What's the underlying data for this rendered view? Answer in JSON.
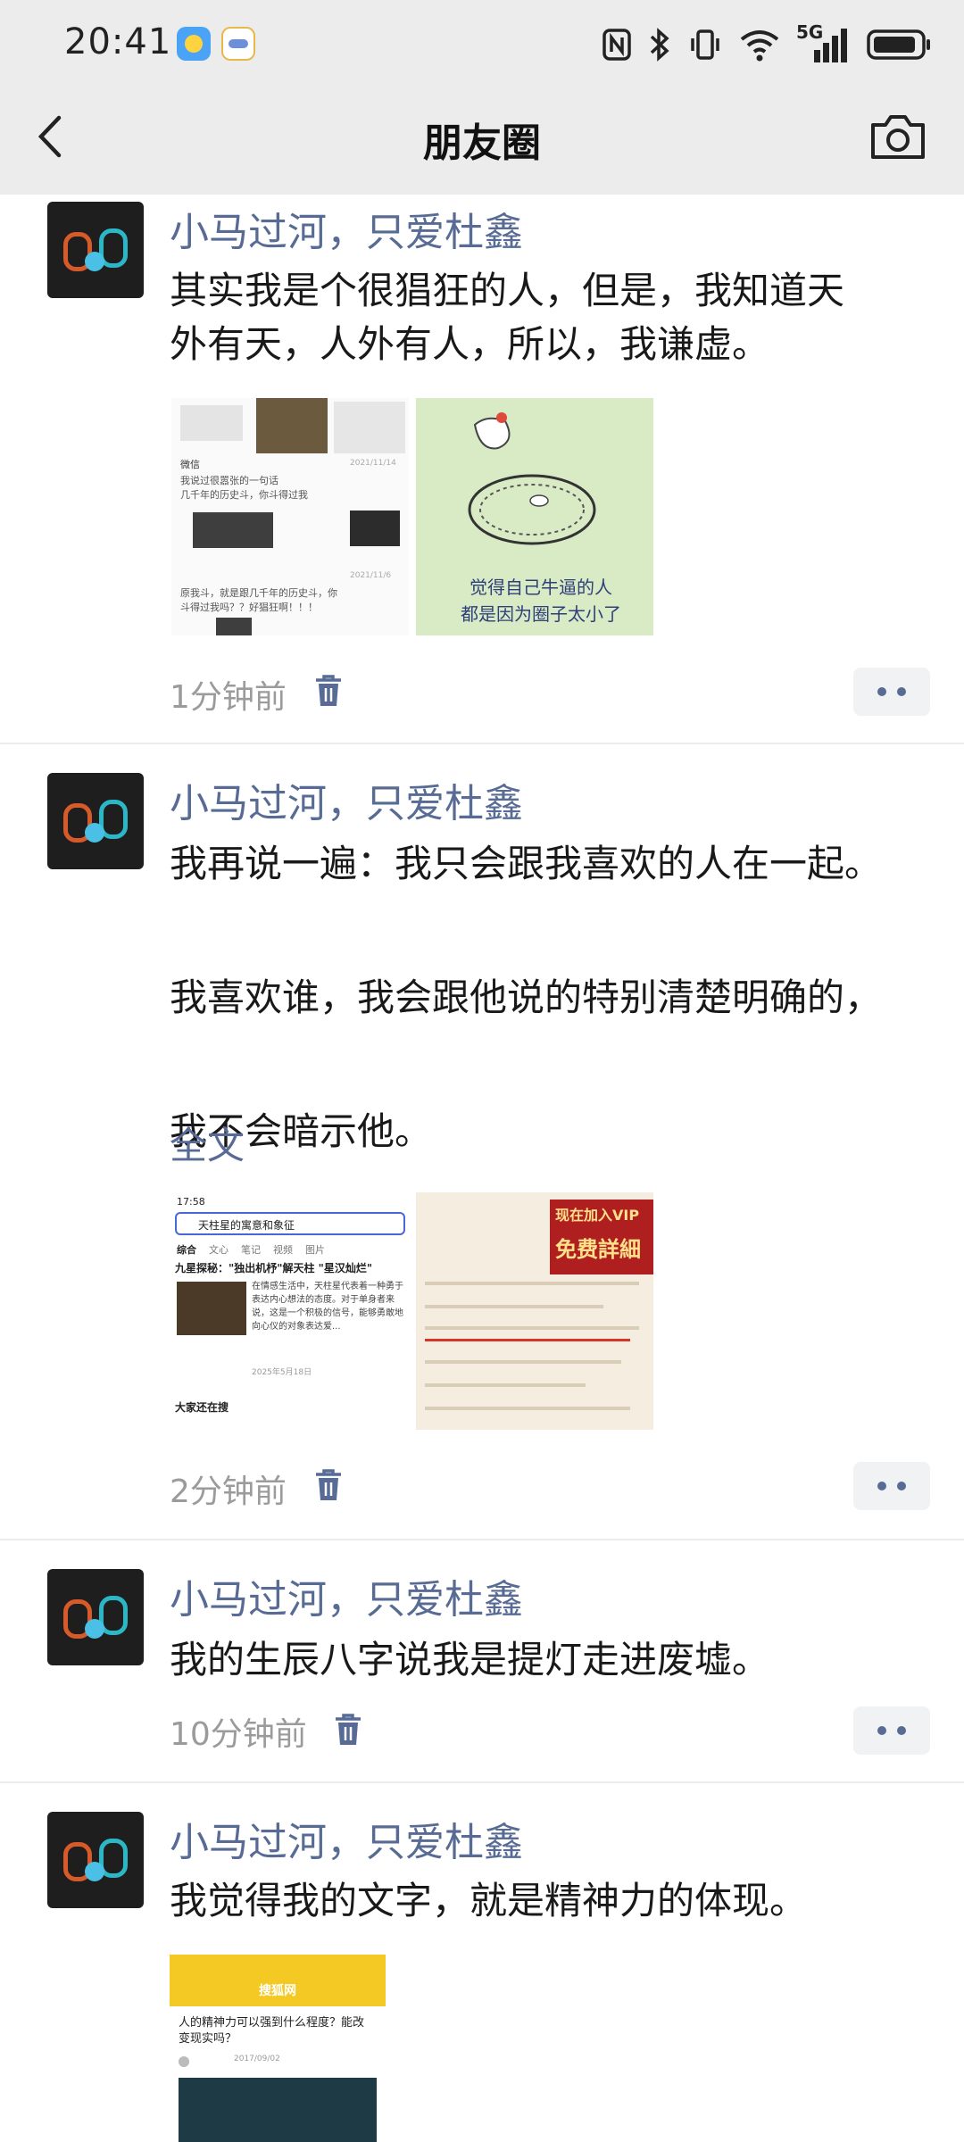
{
  "status_bar": {
    "time": "20:41",
    "network": "5G"
  },
  "header": {
    "title": "朋友圈",
    "back_icon": "chevron-left-icon",
    "camera_icon": "camera-icon"
  },
  "colors": {
    "link": "#576b95",
    "time": "#9b9b9b",
    "header_bg": "#ececec"
  },
  "posts": [
    {
      "author": "小马过河，只爱杜鑫",
      "text_lines": [
        "其实我是个很猖狂的人，但是，我知道天",
        "外有天，人外有人，所以，我谦虚。"
      ],
      "time": "1分钟前",
      "images": [
        {
          "texts": [
            "2021/11/14",
            "我说过很嚣张的一句话",
            "几千年的历史斗，你斗得过我",
            "2021/11/6",
            "原我斗，就是跟几千年的历史斗，你",
            "斗得过我吗？？好猖狂啊！！！"
          ]
        },
        {
          "texts": [
            "觉得自己牛逼的人",
            "都是因为圈子太小了"
          ]
        }
      ]
    },
    {
      "author": "小马过河，只爱杜鑫",
      "text_lines": [
        "我再说一遍：我只会跟我喜欢的人在一起。",
        "",
        "我喜欢谁，我会跟他说的特别清楚明确的，",
        "",
        "我不会暗示他。"
      ],
      "full_text_label": "全文",
      "time": "2分钟前",
      "images": [
        {
          "texts": [
            "17:58",
            "天柱星的寓意和象征",
            "综合",
            "文心",
            "笔记",
            "视频",
            "图片",
            "九星探秘：\"独出机杼\"解天柱 \"星汉灿烂\"",
            "在情感生活中，天柱星代表着一种勇于表达内心想法的态度。对于单身者来说，这是一个积极的信号，能够勇敢地向心仪的对象表达爱...",
            "2025年5月18日",
            "大家还在搜"
          ]
        },
        {
          "texts": [
            "现在加入VIP",
            "免费詳細"
          ]
        }
      ]
    },
    {
      "author": "小马过河，只爱杜鑫",
      "text_lines": [
        "我的生辰八字说我是提灯走进废墟。"
      ],
      "time": "10分钟前",
      "images": []
    },
    {
      "author": "小马过河，只爱杜鑫",
      "text_lines": [
        "我觉得我的文字，就是精神力的体现。"
      ],
      "time": "",
      "images": [
        {
          "texts": [
            "搜狐网",
            "人的精神力可以强到什么程度？能改变现实吗？",
            "2017/09/02"
          ]
        }
      ]
    }
  ]
}
